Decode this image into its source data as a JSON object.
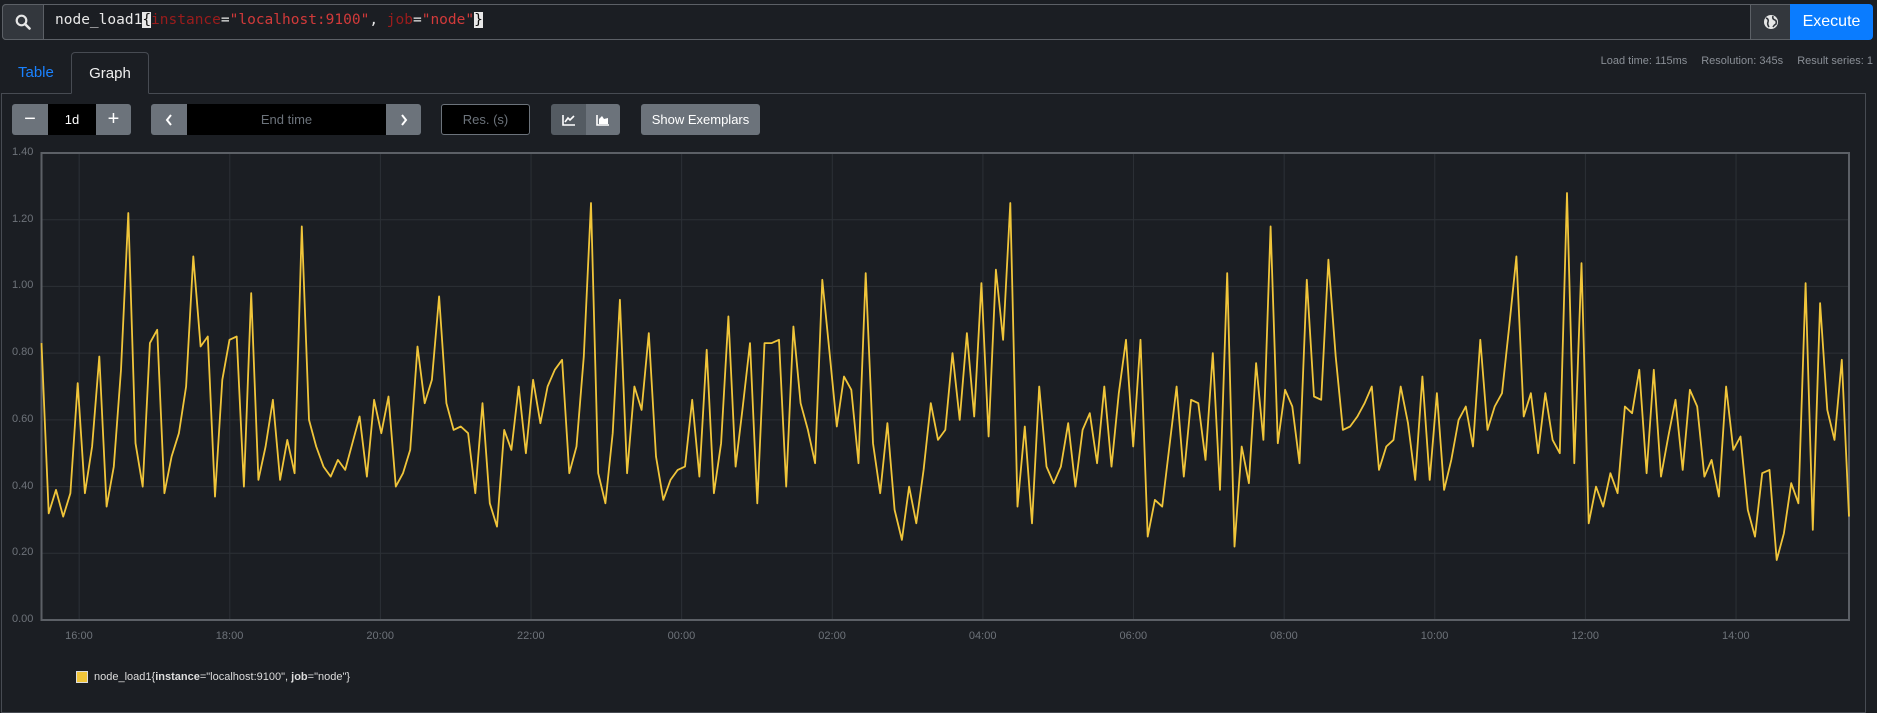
{
  "query": {
    "metric": "node_load1",
    "open_brace": "{",
    "label1": "instance",
    "eq": "=",
    "value1": "\"localhost:9100\"",
    "sep": ", ",
    "label2": "job",
    "value2": "\"node\"",
    "close_brace": "}"
  },
  "toolbar": {
    "execute_label": "Execute",
    "search_icon": "search-icon",
    "globe_icon": "globe-icon"
  },
  "tabs": [
    {
      "label": "Table",
      "active": false
    },
    {
      "label": "Graph",
      "active": true
    }
  ],
  "stats": {
    "load_time": "Load time: 115ms",
    "resolution": "Resolution: 345s",
    "result_series": "Result series: 1"
  },
  "controls": {
    "range_minus": "−",
    "range_value": "1d",
    "range_plus": "+",
    "end_time_placeholder": "End time",
    "resolution_placeholder": "Res. (s)",
    "show_exemplars_label": "Show Exemplars",
    "chart_mode": "lines"
  },
  "colors": {
    "accent": "#0a7cff",
    "series": "#f0c53a",
    "background": "#1b1e23"
  },
  "legend": {
    "metric": "node_load1",
    "open": "{",
    "label1": "instance",
    "value1": "=\"localhost:9100\", ",
    "label2": "job",
    "value2": "=\"node\"",
    "close": "}"
  },
  "chart_data": {
    "type": "line",
    "title": "",
    "xlabel": "",
    "ylabel": "",
    "x_range": [
      "15:30",
      "15:30 (+1d)"
    ],
    "step_seconds": 345,
    "ylim": [
      0,
      1.4
    ],
    "yticks": [
      "0.00",
      "0.20",
      "0.40",
      "0.60",
      "0.80",
      "1.00",
      "1.20",
      "1.40"
    ],
    "xticks": [
      "16:00",
      "18:00",
      "20:00",
      "22:00",
      "00:00",
      "02:00",
      "04:00",
      "06:00",
      "08:00",
      "10:00",
      "12:00",
      "14:00"
    ],
    "grid": true,
    "legend_position": "bottom-left",
    "series": [
      {
        "name": "node_load1{instance=\"localhost:9100\", job=\"node\"}",
        "values": [
          0.83,
          0.32,
          0.39,
          0.31,
          0.38,
          0.71,
          0.38,
          0.52,
          0.79,
          0.34,
          0.46,
          0.75,
          1.22,
          0.53,
          0.4,
          0.83,
          0.87,
          0.38,
          0.49,
          0.56,
          0.7,
          1.09,
          0.82,
          0.85,
          0.37,
          0.72,
          0.84,
          0.85,
          0.4,
          0.98,
          0.42,
          0.52,
          0.66,
          0.42,
          0.54,
          0.44,
          1.18,
          0.6,
          0.52,
          0.46,
          0.43,
          0.48,
          0.45,
          0.53,
          0.61,
          0.43,
          0.66,
          0.56,
          0.67,
          0.4,
          0.44,
          0.51,
          0.82,
          0.65,
          0.72,
          0.97,
          0.65,
          0.57,
          0.58,
          0.56,
          0.38,
          0.65,
          0.35,
          0.28,
          0.57,
          0.51,
          0.7,
          0.5,
          0.72,
          0.59,
          0.7,
          0.75,
          0.78,
          0.44,
          0.52,
          0.79,
          1.25,
          0.44,
          0.35,
          0.56,
          0.96,
          0.44,
          0.7,
          0.63,
          0.86,
          0.49,
          0.36,
          0.42,
          0.45,
          0.46,
          0.66,
          0.43,
          0.81,
          0.38,
          0.53,
          0.91,
          0.46,
          0.64,
          0.83,
          0.35,
          0.83,
          0.83,
          0.84,
          0.4,
          0.88,
          0.65,
          0.57,
          0.47,
          1.02,
          0.8,
          0.58,
          0.73,
          0.69,
          0.47,
          1.04,
          0.53,
          0.38,
          0.59,
          0.33,
          0.24,
          0.4,
          0.29,
          0.45,
          0.65,
          0.54,
          0.57,
          0.8,
          0.6,
          0.86,
          0.61,
          1.01,
          0.55,
          1.05,
          0.84,
          1.25,
          0.34,
          0.58,
          0.29,
          0.7,
          0.46,
          0.41,
          0.46,
          0.59,
          0.4,
          0.57,
          0.62,
          0.47,
          0.7,
          0.46,
          0.68,
          0.84,
          0.52,
          0.84,
          0.25,
          0.36,
          0.34,
          0.52,
          0.7,
          0.43,
          0.66,
          0.65,
          0.48,
          0.8,
          0.39,
          1.04,
          0.22,
          0.52,
          0.41,
          0.77,
          0.54,
          1.18,
          0.53,
          0.69,
          0.64,
          0.47,
          1.02,
          0.67,
          0.66,
          1.08,
          0.79,
          0.57,
          0.58,
          0.61,
          0.65,
          0.7,
          0.45,
          0.52,
          0.54,
          0.7,
          0.59,
          0.42,
          0.73,
          0.42,
          0.68,
          0.39,
          0.48,
          0.6,
          0.64,
          0.52,
          0.84,
          0.57,
          0.64,
          0.68,
          0.88,
          1.09,
          0.61,
          0.68,
          0.5,
          0.68,
          0.54,
          0.5,
          1.28,
          0.47,
          1.07,
          0.29,
          0.4,
          0.34,
          0.44,
          0.38,
          0.64,
          0.62,
          0.75,
          0.44,
          0.75,
          0.43,
          0.55,
          0.66,
          0.45,
          0.69,
          0.64,
          0.43,
          0.48,
          0.37,
          0.7,
          0.51,
          0.55,
          0.33,
          0.25,
          0.44,
          0.45,
          0.18,
          0.26,
          0.41,
          0.35,
          1.01,
          0.27,
          0.95,
          0.63,
          0.54,
          0.78,
          0.31
        ]
      }
    ]
  }
}
